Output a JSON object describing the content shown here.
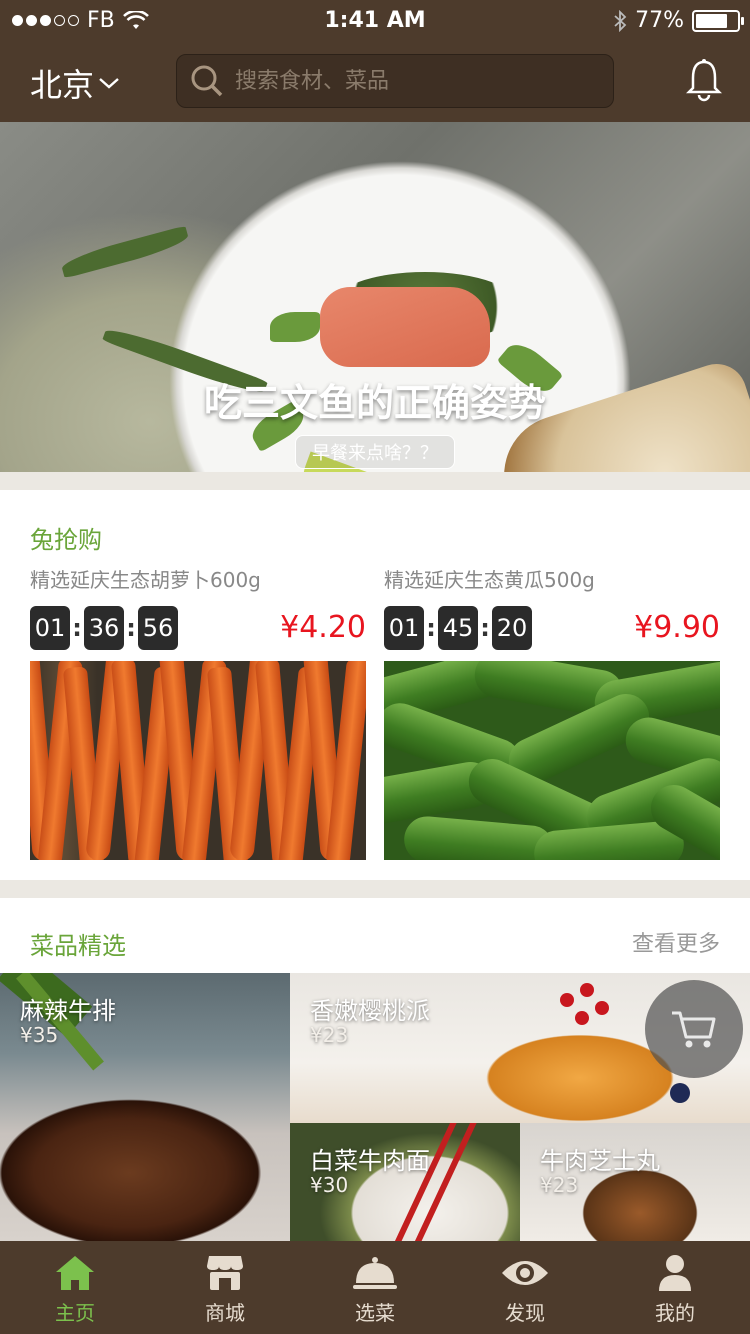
{
  "status_bar": {
    "carrier": "FB",
    "time": "1:41 AM",
    "battery": "77%",
    "battery_level": 0.77
  },
  "header": {
    "city": "北京",
    "search_placeholder": "搜索食材、菜品"
  },
  "banner": {
    "title": "吃三文鱼的正确姿势",
    "subtitle": "早餐来点啥？？",
    "active_index": 1,
    "count": 3
  },
  "flash_sale": {
    "title": "兔抢购",
    "items": [
      {
        "name": "精选延庆生态胡萝卜600g",
        "timer": [
          "01",
          "36",
          "56"
        ],
        "price": "¥4.20",
        "image": "carrots"
      },
      {
        "name": "精选延庆生态黄瓜500g",
        "timer": [
          "01",
          "45",
          "20"
        ],
        "price": "¥9.90",
        "image": "cucumbers"
      }
    ]
  },
  "picks": {
    "title": "菜品精选",
    "more": "查看更多",
    "dishes": [
      {
        "name": "麻辣牛排",
        "price": "¥35"
      },
      {
        "name": "香嫩樱桃派",
        "price": "¥23"
      },
      {
        "name": "白菜牛肉面",
        "price": "¥30"
      },
      {
        "name": "牛肉芝士丸",
        "price": "¥23"
      }
    ]
  },
  "tabs": [
    {
      "label": "主页",
      "icon": "home-icon",
      "active": true
    },
    {
      "label": "商城",
      "icon": "store-icon",
      "active": false
    },
    {
      "label": "选菜",
      "icon": "cloche-icon",
      "active": false
    },
    {
      "label": "发现",
      "icon": "eye-icon",
      "active": false
    },
    {
      "label": "我的",
      "icon": "user-icon",
      "active": false
    }
  ],
  "colors": {
    "header_bg": "#4d3b2c",
    "accent_green": "#6aa53a",
    "price_red": "#e8151f"
  }
}
